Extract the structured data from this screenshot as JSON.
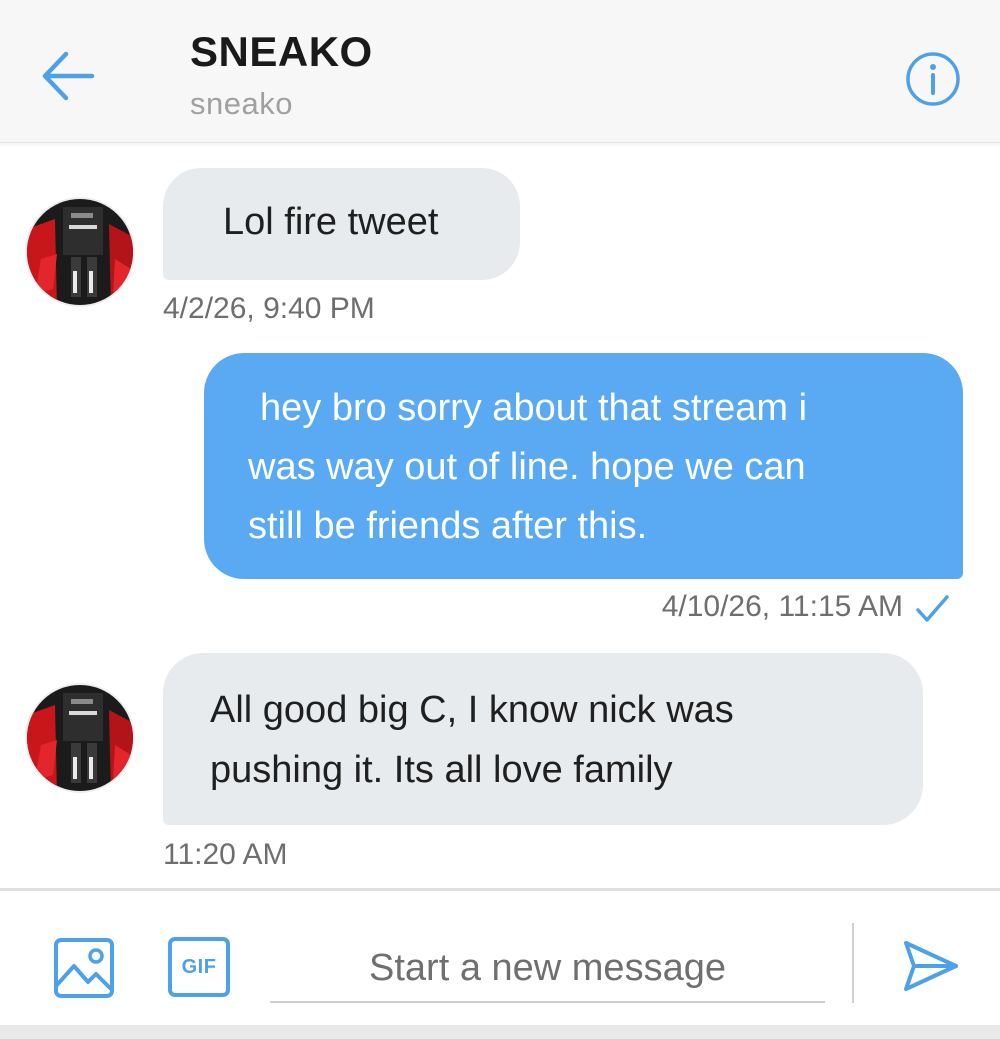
{
  "header": {
    "title": "SNEAKO",
    "handle": "sneako",
    "back_icon": "arrow-left-icon",
    "info_icon": "info-circle-icon"
  },
  "messages": [
    {
      "direction": "incoming",
      "lines": [
        "Lol fire tweet"
      ],
      "timestamp": "4/2/26, 9:40 PM",
      "avatar_icon": "avatar"
    },
    {
      "direction": "outgoing",
      "lines": [
        "hey bro sorry about that stream i",
        "was way out of line. hope we can",
        "still be friends after this."
      ],
      "timestamp": "4/10/26, 11:15 AM",
      "status_icon": "checkmark-icon"
    },
    {
      "direction": "incoming",
      "lines": [
        "All good big C, I know nick was",
        "pushing it. Its all love family"
      ],
      "timestamp": "11:20 AM",
      "avatar_icon": "avatar"
    }
  ],
  "composer": {
    "image_icon": "image-icon",
    "gif_label": "GIF",
    "placeholder": "Start a new message",
    "value": "",
    "send_icon": "send-icon"
  },
  "colors": {
    "accent": "#4da1ea",
    "outgoing_bubble": "#5aa9f3",
    "incoming_bubble": "#e8ebee",
    "header_bg": "#f7f7f7"
  }
}
